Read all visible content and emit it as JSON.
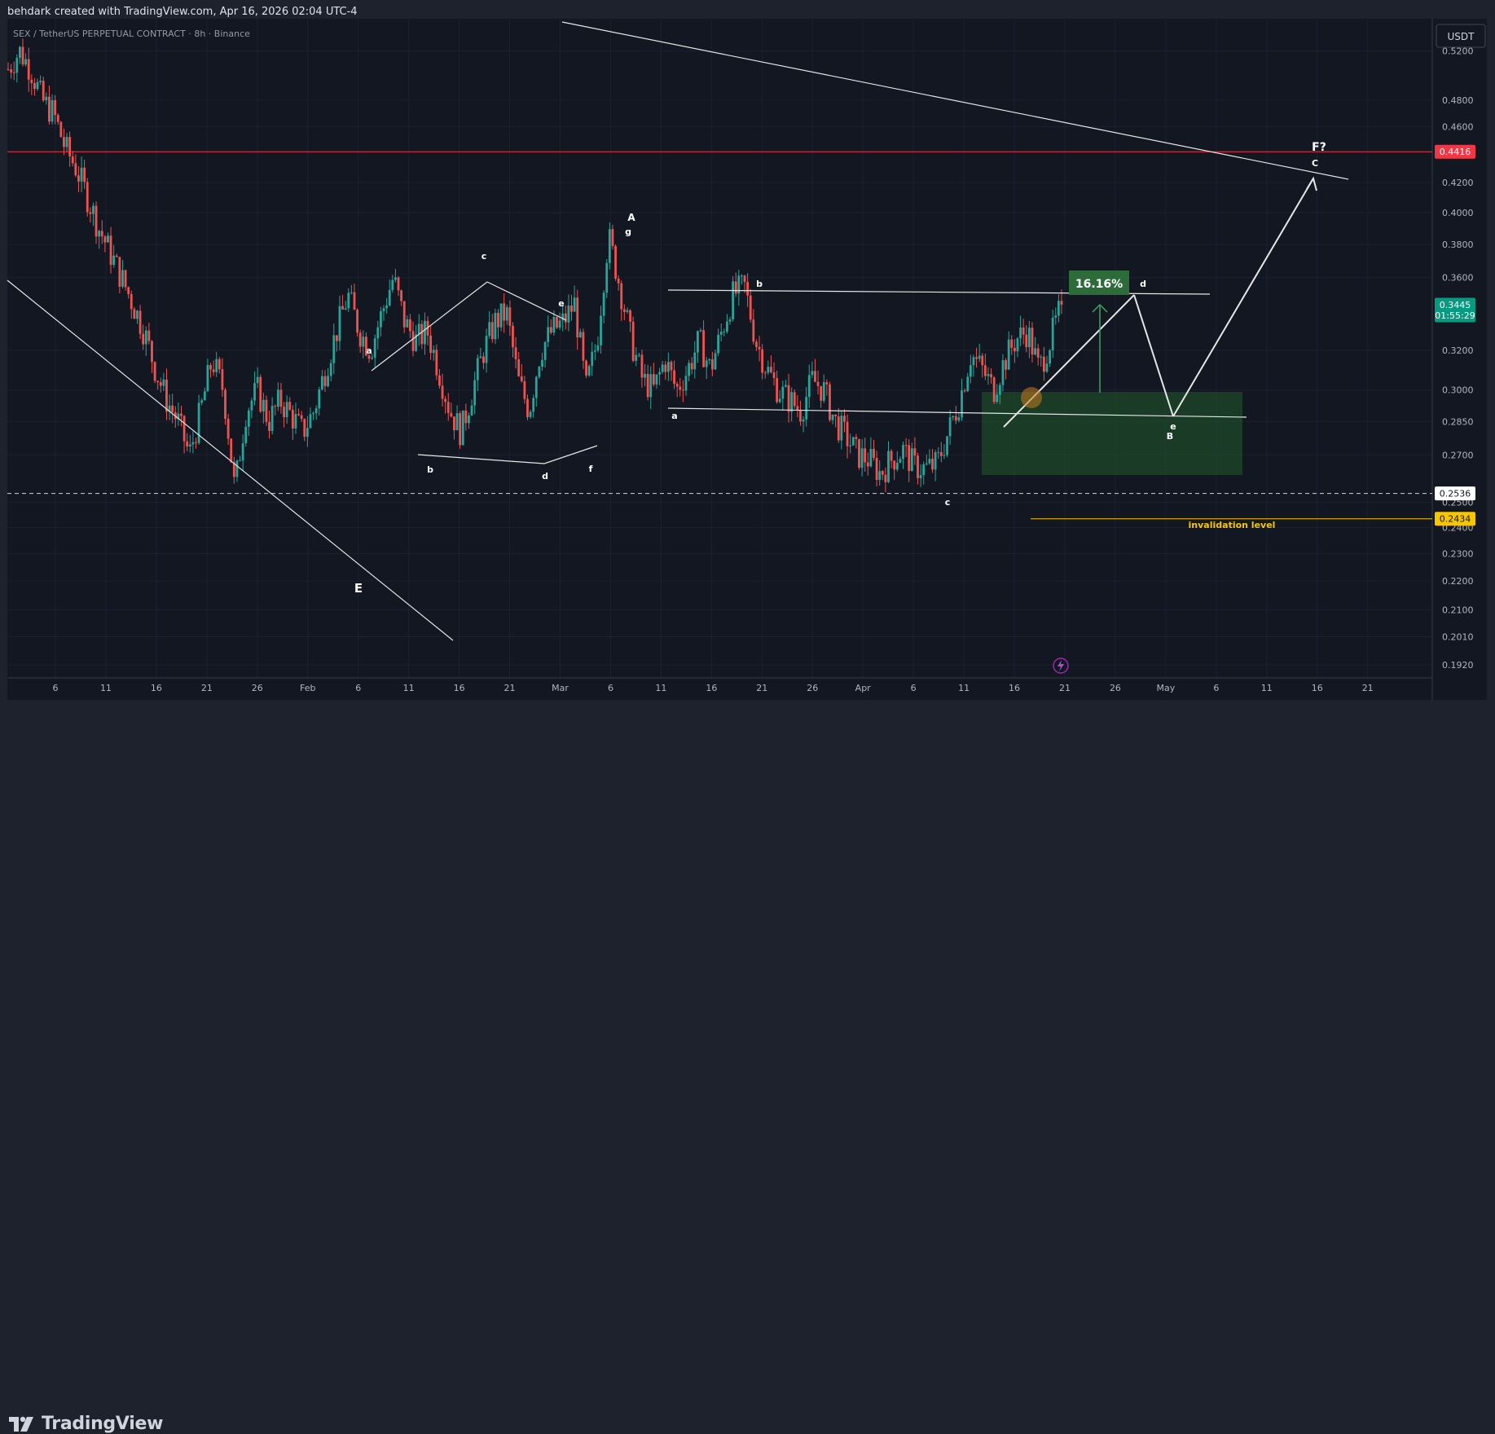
{
  "header": {
    "text": "behdark created with TradingView.com, Apr 16, 2026 02:04 UTC-4"
  },
  "symbol": {
    "text": "SEX / TetherUS PERPETUAL CONTRACT · 8h · Binance"
  },
  "currency_button": {
    "label": "USDT"
  },
  "footer": {
    "brand": "TradingView"
  },
  "colors": {
    "up": "#26a69a",
    "down": "#ef5350",
    "background": "#131722",
    "resistance": "#f23645",
    "invalidation": "#f7c600",
    "target_box": "#2e6b3a"
  },
  "chart_data": {
    "type": "candlestick",
    "timeframe": "8h",
    "y_scale": "log",
    "ylim": [
      0.188,
      0.548
    ],
    "y_ticks": [
      "0.5200",
      "0.4800",
      "0.4600",
      "0.4200",
      "0.4000",
      "0.3800",
      "0.3600",
      "0.3200",
      "0.3000",
      "0.2850",
      "0.2700",
      "0.2500",
      "0.2400",
      "0.2300",
      "0.2200",
      "0.2100",
      "0.2010",
      "0.1920"
    ],
    "x_ticks": [
      "6",
      "11",
      "16",
      "21",
      "26",
      "Feb",
      "6",
      "11",
      "16",
      "21",
      "Mar",
      "6",
      "11",
      "16",
      "21",
      "26",
      "Apr",
      "6",
      "11",
      "16",
      "21",
      "26",
      "May",
      "6",
      "11",
      "16",
      "21"
    ],
    "price_labels": [
      {
        "text": "0.4416",
        "value": 0.4416,
        "color": "#f23645"
      },
      {
        "text": "0.3445",
        "value": 0.3445,
        "sub": "01:55:29",
        "color": "#089981"
      },
      {
        "text": "0.2536",
        "value": 0.2536,
        "color": "#ffffff"
      },
      {
        "text": "0.2434",
        "value": 0.2434,
        "color": "#f7c600"
      }
    ],
    "path_close": [
      0.505,
      0.52,
      0.505,
      0.48,
      0.47,
      0.445,
      0.43,
      0.41,
      0.39,
      0.375,
      0.36,
      0.345,
      0.33,
      0.31,
      0.295,
      0.285,
      0.27,
      0.29,
      0.315,
      0.3,
      0.255,
      0.29,
      0.3,
      0.285,
      0.295,
      0.288,
      0.28,
      0.29,
      0.31,
      0.33,
      0.35,
      0.33,
      0.32,
      0.34,
      0.36,
      0.335,
      0.325,
      0.33,
      0.31,
      0.29,
      0.28,
      0.3,
      0.32,
      0.335,
      0.34,
      0.305,
      0.29,
      0.32,
      0.33,
      0.335,
      0.345,
      0.3,
      0.325,
      0.385,
      0.355,
      0.325,
      0.305,
      0.3,
      0.315,
      0.3,
      0.31,
      0.325,
      0.31,
      0.33,
      0.35,
      0.355,
      0.325,
      0.31,
      0.3,
      0.295,
      0.29,
      0.305,
      0.3,
      0.285,
      0.278,
      0.27,
      0.268,
      0.262,
      0.268,
      0.272,
      0.265,
      0.264,
      0.266,
      0.28,
      0.295,
      0.318,
      0.31,
      0.3,
      0.315,
      0.326,
      0.33,
      0.31,
      0.325,
      0.3445
    ],
    "annotations": {
      "labels": [
        "E",
        "a",
        "b",
        "c",
        "d",
        "e",
        "f",
        "A",
        "g",
        "b",
        "a",
        "c",
        "d",
        "e",
        "B",
        "F?",
        "C"
      ],
      "target_percent": "16.16%",
      "invalidation": "invalidation level"
    }
  }
}
